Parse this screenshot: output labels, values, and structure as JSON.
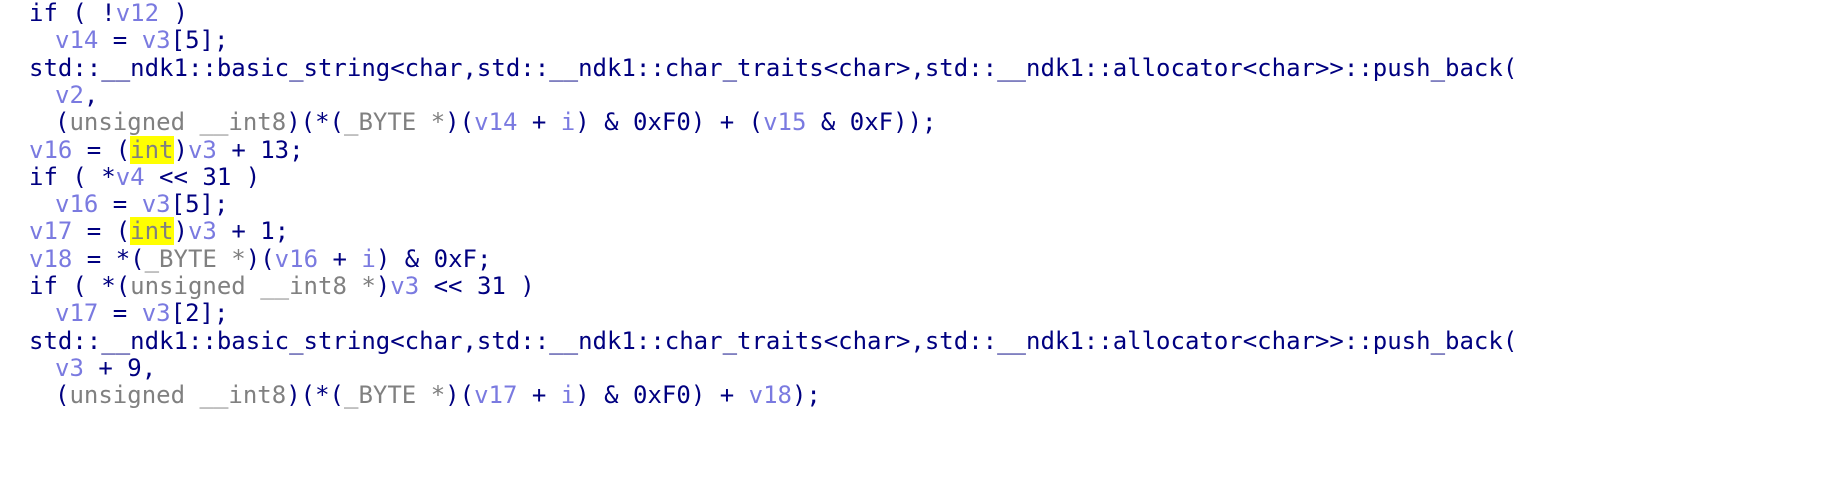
{
  "editor": {
    "view": "pseudocode",
    "highlight_color": "#ffff00",
    "colors": {
      "keyword": "#000080",
      "variable": "#7a7ae0",
      "type": "#808080",
      "background": "#ffffff"
    },
    "lines": [
      {
        "indent": 1,
        "tokens": [
          {
            "t": "if ( !",
            "c": "kw"
          },
          {
            "t": "v12",
            "c": "var"
          },
          {
            "t": " )",
            "c": "kw"
          }
        ]
      },
      {
        "indent": 2,
        "tokens": [
          {
            "t": "v14",
            "c": "var"
          },
          {
            "t": " = ",
            "c": "kw"
          },
          {
            "t": "v3",
            "c": "var"
          },
          {
            "t": "[5];",
            "c": "kw"
          }
        ]
      },
      {
        "indent": 1,
        "tokens": [
          {
            "t": "std::__ndk1::basic_string<char,std::__ndk1::char_traits<char>,std::__ndk1::allocator<char>>::push_back(",
            "c": "kw"
          }
        ]
      },
      {
        "indent": 2,
        "tokens": [
          {
            "t": "v2",
            "c": "var"
          },
          {
            "t": ",",
            "c": "kw"
          }
        ]
      },
      {
        "indent": 2,
        "tokens": [
          {
            "t": "(",
            "c": "kw"
          },
          {
            "t": "unsigned __int8",
            "c": "type"
          },
          {
            "t": ")(*(",
            "c": "kw"
          },
          {
            "t": "_BYTE *",
            "c": "type"
          },
          {
            "t": ")(",
            "c": "kw"
          },
          {
            "t": "v14",
            "c": "var"
          },
          {
            "t": " + ",
            "c": "kw"
          },
          {
            "t": "i",
            "c": "var"
          },
          {
            "t": ") & 0xF0) + (",
            "c": "kw"
          },
          {
            "t": "v15",
            "c": "var"
          },
          {
            "t": " & 0xF));",
            "c": "kw"
          }
        ]
      },
      {
        "indent": 1,
        "tokens": [
          {
            "t": "v16",
            "c": "var"
          },
          {
            "t": " = (",
            "c": "kw"
          },
          {
            "t": "int",
            "c": "hl"
          },
          {
            "t": ")",
            "c": "kw"
          },
          {
            "t": "v3",
            "c": "var"
          },
          {
            "t": " + 13;",
            "c": "kw"
          }
        ]
      },
      {
        "indent": 1,
        "tokens": [
          {
            "t": "if ( *",
            "c": "kw"
          },
          {
            "t": "v4",
            "c": "var"
          },
          {
            "t": " << 31 )",
            "c": "kw"
          }
        ]
      },
      {
        "indent": 2,
        "tokens": [
          {
            "t": "v16",
            "c": "var"
          },
          {
            "t": " = ",
            "c": "kw"
          },
          {
            "t": "v3",
            "c": "var"
          },
          {
            "t": "[5];",
            "c": "kw"
          }
        ]
      },
      {
        "indent": 1,
        "tokens": [
          {
            "t": "v17",
            "c": "var"
          },
          {
            "t": " = (",
            "c": "kw"
          },
          {
            "t": "int",
            "c": "hl"
          },
          {
            "t": ")",
            "c": "kw"
          },
          {
            "t": "v3",
            "c": "var"
          },
          {
            "t": " + 1;",
            "c": "kw"
          }
        ]
      },
      {
        "indent": 1,
        "tokens": [
          {
            "t": "v18",
            "c": "var"
          },
          {
            "t": " = *(",
            "c": "kw"
          },
          {
            "t": "_BYTE *",
            "c": "type"
          },
          {
            "t": ")(",
            "c": "kw"
          },
          {
            "t": "v16",
            "c": "var"
          },
          {
            "t": " + ",
            "c": "kw"
          },
          {
            "t": "i",
            "c": "var"
          },
          {
            "t": ") & 0xF;",
            "c": "kw"
          }
        ]
      },
      {
        "indent": 1,
        "tokens": [
          {
            "t": "if ( *(",
            "c": "kw"
          },
          {
            "t": "unsigned __int8 *",
            "c": "type"
          },
          {
            "t": ")",
            "c": "kw"
          },
          {
            "t": "v3",
            "c": "var"
          },
          {
            "t": " << 31 )",
            "c": "kw"
          }
        ]
      },
      {
        "indent": 2,
        "tokens": [
          {
            "t": "v17",
            "c": "var"
          },
          {
            "t": " = ",
            "c": "kw"
          },
          {
            "t": "v3",
            "c": "var"
          },
          {
            "t": "[2];",
            "c": "kw"
          }
        ]
      },
      {
        "indent": 1,
        "tokens": [
          {
            "t": "std::__ndk1::basic_string<char,std::__ndk1::char_traits<char>,std::__ndk1::allocator<char>>::push_back(",
            "c": "kw"
          }
        ]
      },
      {
        "indent": 2,
        "tokens": [
          {
            "t": "v3",
            "c": "var"
          },
          {
            "t": " + 9,",
            "c": "kw"
          }
        ]
      },
      {
        "indent": 2,
        "tokens": [
          {
            "t": "(",
            "c": "kw"
          },
          {
            "t": "unsigned __int8",
            "c": "type"
          },
          {
            "t": ")(*(",
            "c": "kw"
          },
          {
            "t": "_BYTE *",
            "c": "type"
          },
          {
            "t": ")(",
            "c": "kw"
          },
          {
            "t": "v17",
            "c": "var"
          },
          {
            "t": " + ",
            "c": "kw"
          },
          {
            "t": "i",
            "c": "var"
          },
          {
            "t": ") & 0xF0) + ",
            "c": "kw"
          },
          {
            "t": "v18",
            "c": "var"
          },
          {
            "t": ");",
            "c": "kw"
          }
        ]
      }
    ]
  }
}
